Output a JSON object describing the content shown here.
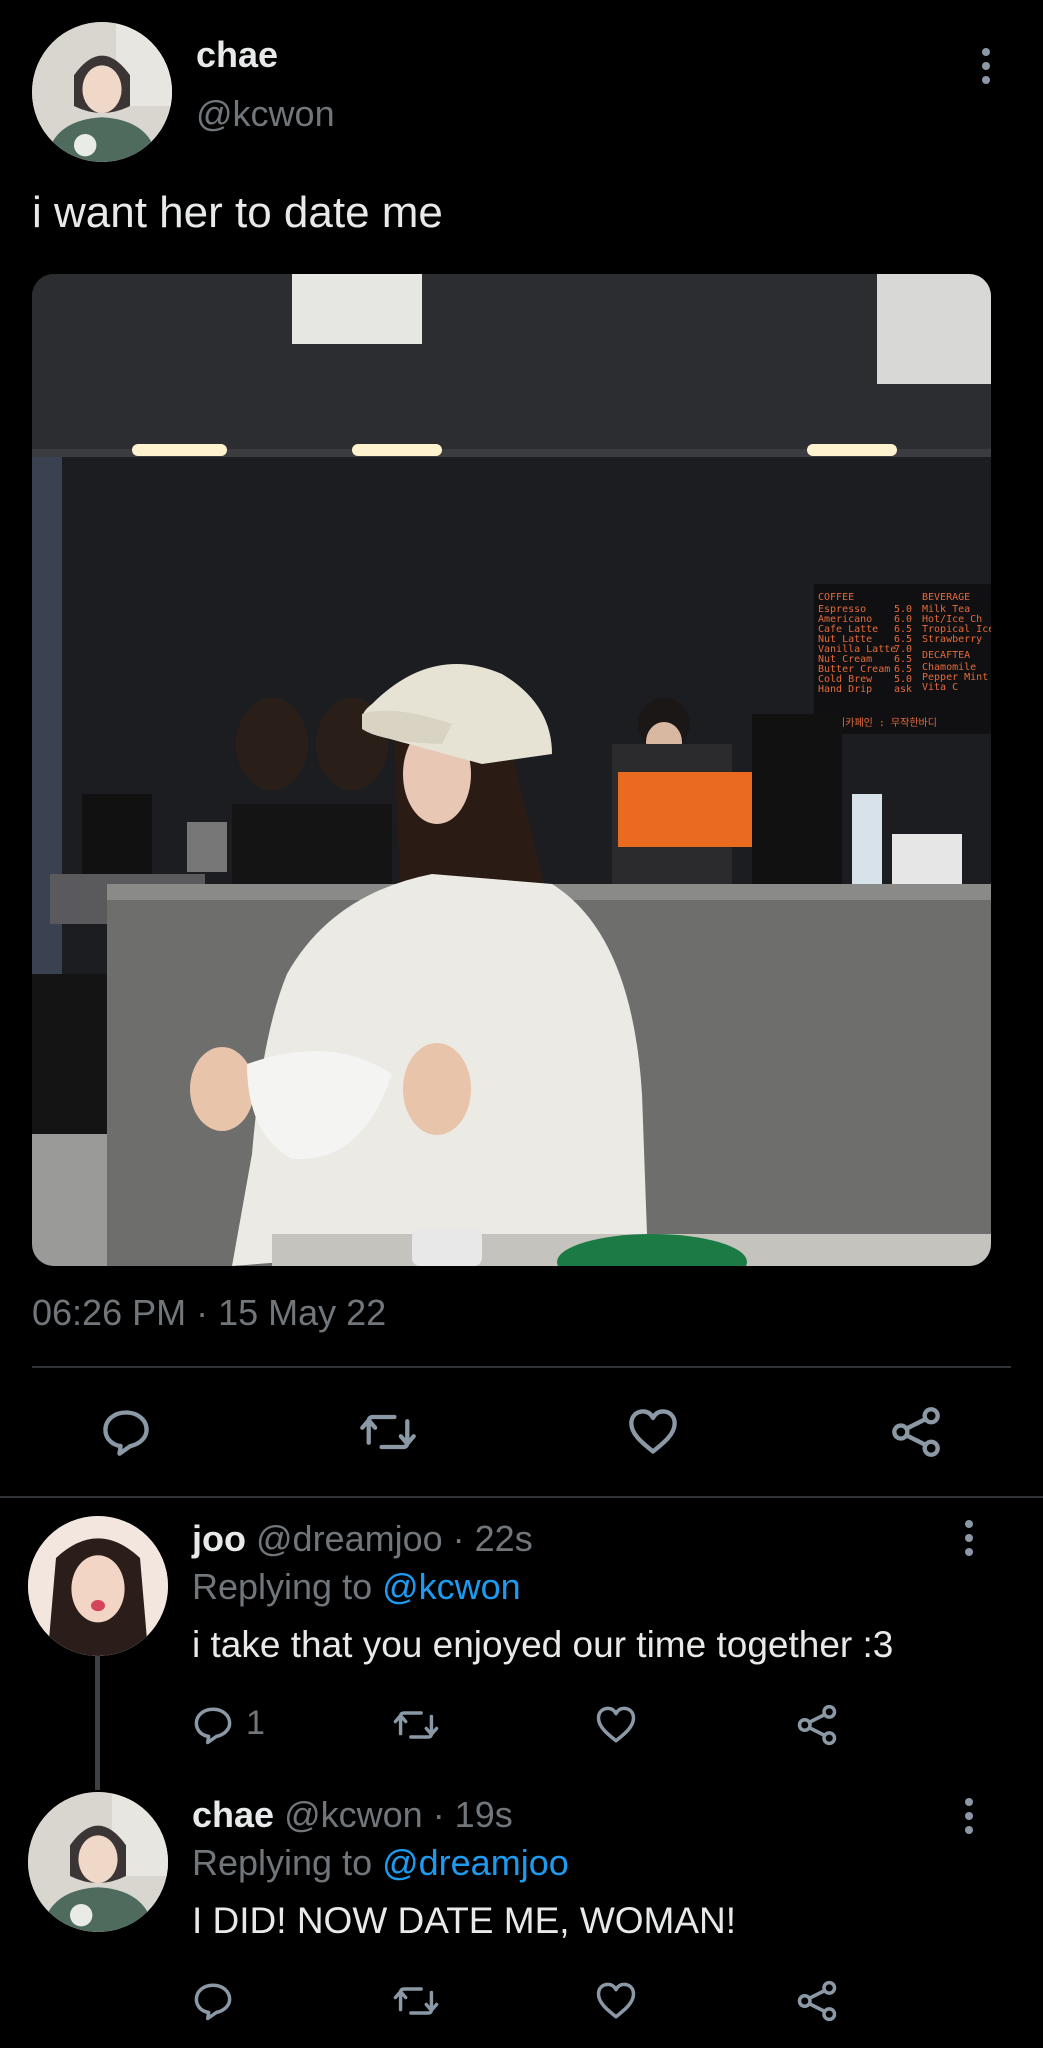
{
  "main_tweet": {
    "display_name": "chae",
    "handle": "@kcwon",
    "text": "i want her to date me",
    "image_alt_visible": false,
    "menu_sign": "…",
    "menu_signage": {
      "coffee_header": "COFFEE",
      "coffee_items": [
        "Espresso",
        "Americano",
        "Cafe Latte",
        "Nut Latte",
        "Vanilla Latte",
        "Nut Cream",
        "Butter Cream",
        "Cold Brew",
        "Hand Drip"
      ],
      "prices": [
        "5.0",
        "6.0",
        "6.5",
        "6.5",
        "7.0",
        "6.5",
        "6.5",
        "5.0",
        "ask"
      ],
      "beverage_header": "BEVERAGE",
      "beverage_items": [
        "Milk Tea",
        "Hot/Ice Ch",
        "Tropical Ice",
        "Strawberry"
      ],
      "decaf_header": "DECAFTEA",
      "decaf_items": [
        "Chamomile",
        "Pepper Mint",
        "Vita C"
      ],
      "bottom_line": "#3 디카페인 : 무작한바디"
    },
    "timestamp": "06:26 PM · 15 May 22"
  },
  "actions_main": {
    "reply_icon": "reply-icon",
    "retweet_icon": "retweet-icon",
    "like_icon": "heart-icon",
    "share_icon": "share-icon"
  },
  "replies": [
    {
      "display_name": "joo",
      "handle": "@dreamjoo",
      "time": "· 22s",
      "replying_prefix": "Replying to ",
      "replying_to": "@kcwon",
      "text": "i take that you enjoyed our time together :3",
      "reply_count": "1"
    },
    {
      "display_name": "chae",
      "handle": "@kcwon",
      "time": "· 19s",
      "replying_prefix": "Replying to ",
      "replying_to": "@dreamjoo",
      "text": "I DID! NOW DATE ME, WOMAN!",
      "reply_count": ""
    }
  ],
  "colors": {
    "background": "#000000",
    "text": "#e7e9ea",
    "muted": "#71767b",
    "link": "#1d9bf0",
    "divider": "#2f3336"
  }
}
